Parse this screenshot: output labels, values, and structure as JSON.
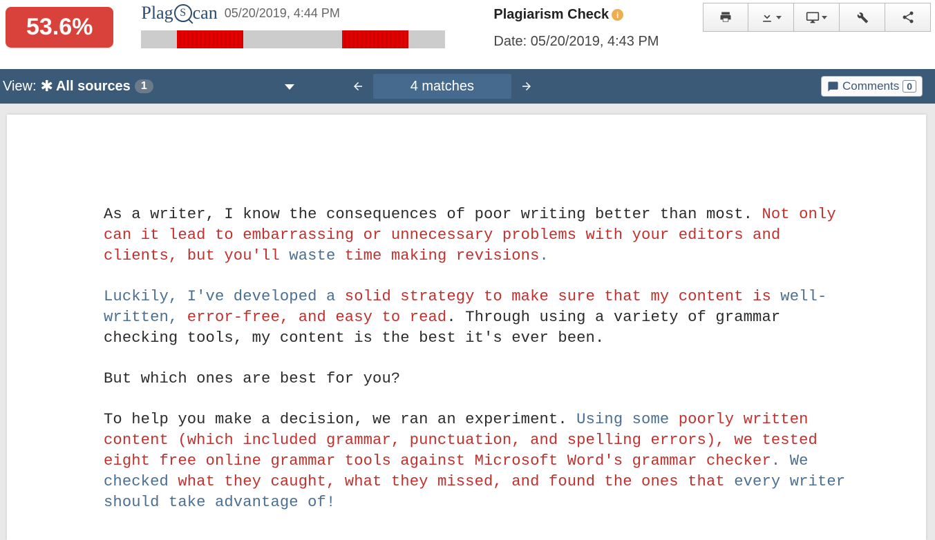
{
  "header": {
    "percentage": "53.6%",
    "logo_date": "05/20/2019, 4:44 PM",
    "title": "Plagiarism Check",
    "date_label": "Date: 05/20/2019, 4:43 PM"
  },
  "nav": {
    "view_label": "View:",
    "view_name": "All sources",
    "view_count": "1",
    "matches": "4 matches",
    "comments_label": "Comments",
    "comments_count": "0"
  },
  "doc": {
    "p1_a": "As a writer, I know the consequences of poor writing better than most. ",
    "p1_b": "Not only can it lead to embarrassing or unnecessary problems with your editors and clients, but you'll ",
    "p1_c": "waste ",
    "p1_d": "time making revisions",
    "p1_e": ".",
    "p2_a": "Luckily, I've developed a ",
    "p2_b": "solid strategy to make sure that my content is ",
    "p2_c": "well-written, ",
    "p2_d": "error-free, and easy to read",
    "p2_e": ". Through using a variety of grammar checking tools, my content is the best it's ever been.",
    "p3": "But which ones are best for you?",
    "p4_a": "To help you make a decision, we ran an experiment. ",
    "p4_b": "Using some ",
    "p4_c": "poorly written content (which included grammar, punctuation, and spelling errors), we tested eight free online grammar tools against Microsoft Word's grammar checker",
    "p4_d": ". ",
    "p4_e": "We checked ",
    "p4_f": "what they caught, what they missed, and found the ones that ",
    "p4_g": "every writer should take advantage of!"
  }
}
